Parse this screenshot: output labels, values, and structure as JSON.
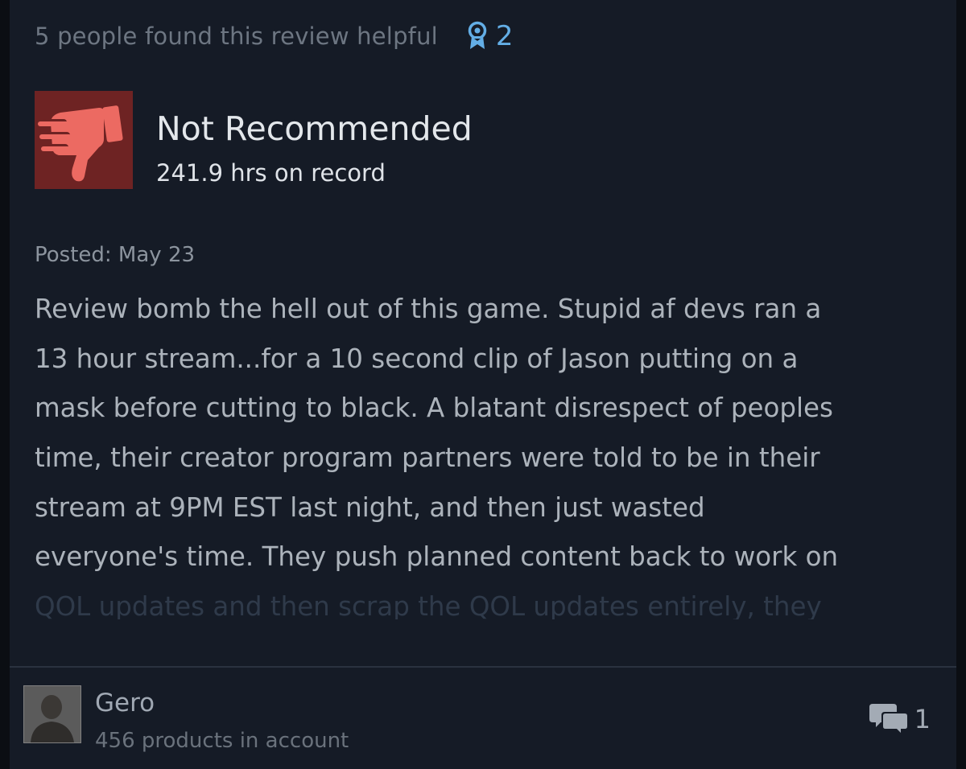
{
  "review": {
    "helpful_text": "5 people found this review helpful",
    "award_count": "2",
    "award_icon": "award-ribbon-icon",
    "rating_icon": "thumbs-down-icon",
    "rating_label": "Not Recommended",
    "hours": "241.9 hrs on record",
    "posted": "Posted: May 23",
    "body_lines": [
      "Review bomb the hell out of this game. Stupid af devs ran a",
      "13 hour stream...for a 10 second clip of Jason putting on a",
      "mask before cutting to black. A blatant disrespect of peoples",
      "time, their creator program partners were told to be in their",
      "stream at 9PM EST last night, and then just wasted",
      "everyone's time. They push planned content back to work on",
      "QOL updates and then scrap the QOL updates entirely, they"
    ]
  },
  "author": {
    "name": "Gero",
    "products": "456 products in account"
  },
  "comments": {
    "count": "1",
    "icon": "comment-bubbles-icon"
  },
  "colors": {
    "background": "#151b26",
    "not_recommended_bg": "#6e2323",
    "thumb": "#ec6a62",
    "award": "#63aee6"
  }
}
